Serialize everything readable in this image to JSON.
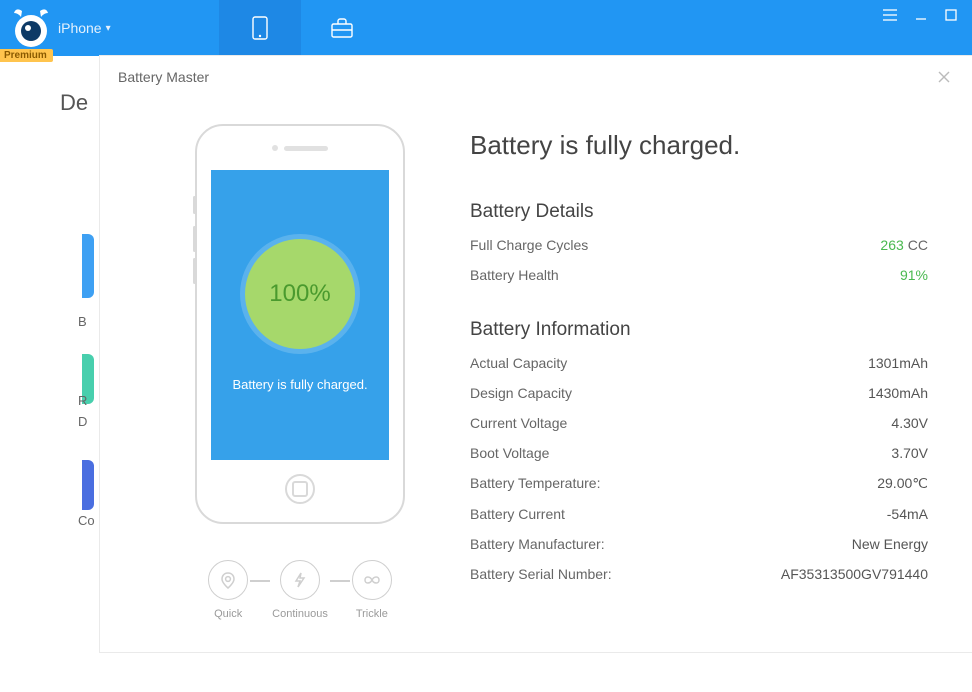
{
  "topbar": {
    "device_label": "iPhone",
    "premium_badge": "Premium"
  },
  "bg": {
    "heading_fragment": "De",
    "label_b": "B",
    "label_r": "R",
    "label_d": "D",
    "label_co": "Co"
  },
  "modal": {
    "title": "Battery Master",
    "status_headline": "Battery is fully charged.",
    "phone": {
      "percent": "100%",
      "caption": "Battery is fully charged."
    },
    "modes": {
      "quick": "Quick",
      "continuous": "Continuous",
      "trickle": "Trickle"
    },
    "details": {
      "heading": "Battery Details",
      "rows": [
        {
          "label": "Full Charge Cycles",
          "value": "263",
          "suffix": "CC",
          "green": true
        },
        {
          "label": "Battery Health",
          "value": "91%",
          "suffix": "",
          "green": true
        }
      ]
    },
    "info": {
      "heading": "Battery Information",
      "rows": [
        {
          "label": "Actual Capacity",
          "value": "1301mAh"
        },
        {
          "label": "Design Capacity",
          "value": "1430mAh"
        },
        {
          "label": "Current Voltage",
          "value": "4.30V"
        },
        {
          "label": "Boot Voltage",
          "value": "3.70V"
        },
        {
          "label": "Battery Temperature:",
          "value": "29.00℃"
        },
        {
          "label": "Battery Current",
          "value": "-54mA"
        },
        {
          "label": "Battery Manufacturer:",
          "value": "New Energy"
        },
        {
          "label": "Battery Serial Number:",
          "value": "AF35313500GV791440"
        }
      ]
    }
  }
}
